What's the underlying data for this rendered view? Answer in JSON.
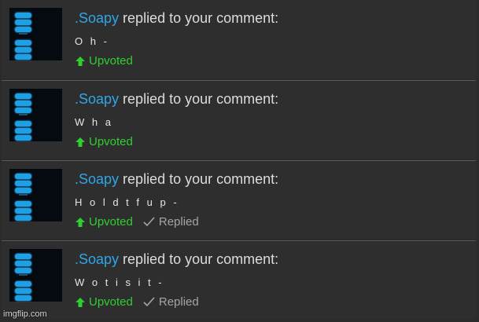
{
  "notifications": [
    {
      "user": ".Soapy",
      "action": " replied to your comment:",
      "text": "O h -",
      "upvote": "Upvoted",
      "replied": ""
    },
    {
      "user": ".Soapy",
      "action": " replied to your comment:",
      "text": "W h a",
      "upvote": "Upvoted",
      "replied": ""
    },
    {
      "user": ".Soapy",
      "action": " replied to your comment:",
      "text": "H o l d t f u p -",
      "upvote": "Upvoted",
      "replied": "Replied"
    },
    {
      "user": ".Soapy",
      "action": " replied to your comment:",
      "text": "W o t i s i t -",
      "upvote": "Upvoted",
      "replied": "Replied"
    }
  ],
  "watermark": "imgflip.com",
  "colors": {
    "username": "#2fa6e8",
    "upvoted": "#2fcf2f",
    "replied": "#a5a5a5",
    "background": "#2e2e2e"
  }
}
